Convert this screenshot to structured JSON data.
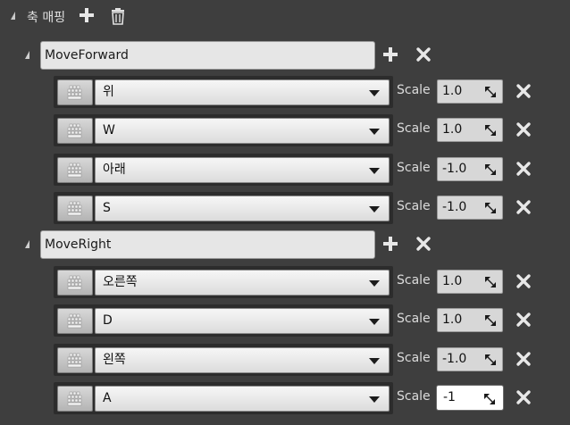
{
  "header": {
    "title": "축 매핑",
    "add_icon": "plus-icon",
    "delete_icon": "trash-icon"
  },
  "labels": {
    "scale": "Scale"
  },
  "groups": [
    {
      "name": "MoveForward",
      "mappings": [
        {
          "key": "위",
          "scale": "1.0"
        },
        {
          "key": "W",
          "scale": "1.0"
        },
        {
          "key": "아래",
          "scale": "-1.0"
        },
        {
          "key": "S",
          "scale": "-1.0"
        }
      ]
    },
    {
      "name": "MoveRight",
      "mappings": [
        {
          "key": "오른쪽",
          "scale": "1.0"
        },
        {
          "key": "D",
          "scale": "1.0"
        },
        {
          "key": "왼쪽",
          "scale": "-1.0"
        },
        {
          "key": "A",
          "scale": "-1"
        }
      ]
    }
  ],
  "colors": {
    "background": "#3e3e3e",
    "row_panel": "#2c2c2c",
    "field": "#e6e6e6",
    "icon": "#e0e0e0"
  }
}
